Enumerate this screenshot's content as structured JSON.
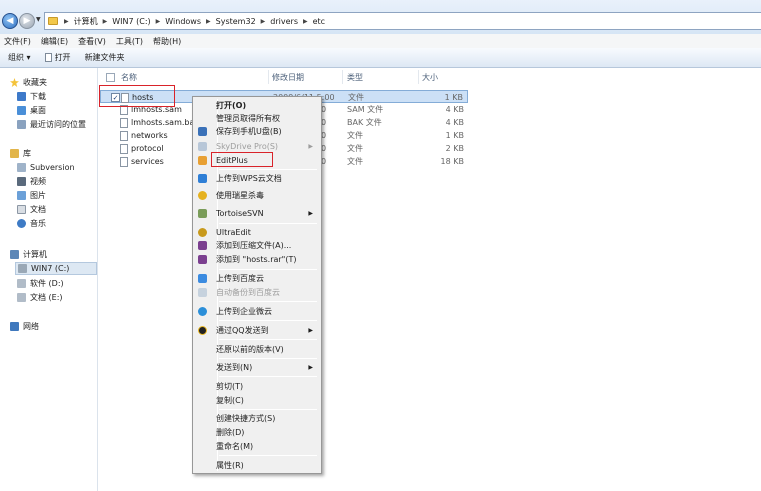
{
  "breadcrumb": {
    "items": [
      "计算机",
      "WIN7 (C:)",
      "Windows",
      "System32",
      "drivers",
      "etc"
    ]
  },
  "menubar": {
    "items": [
      "文件(F)",
      "编辑(E)",
      "查看(V)",
      "工具(T)",
      "帮助(H)"
    ]
  },
  "toolbar": {
    "organize": "组织 ▾",
    "open": "打开",
    "new_folder": "新建文件夹"
  },
  "nav": {
    "favorites": "收藏夹",
    "downloads": "下载",
    "desktop": "桌面",
    "recent": "最近访问的位置",
    "libraries": "库",
    "subversion": "Subversion",
    "videos": "视频",
    "pictures": "图片",
    "documents": "文档",
    "music": "音乐",
    "computer": "计算机",
    "drive_c": "WIN7 (C:)",
    "drive_d": "软件 (D:)",
    "drive_e": "文档 (E:)",
    "network": "网络"
  },
  "columns": {
    "name": "名称",
    "modified": "修改日期",
    "type": "类型",
    "size": "大小"
  },
  "files": [
    {
      "name": "hosts",
      "modified": "2009/6/11 5:00",
      "type": "文件",
      "size": "1 KB",
      "checked": "✓"
    },
    {
      "name": "lmhosts.sam",
      "modified": "0",
      "type": "SAM 文件",
      "size": "4 KB"
    },
    {
      "name": "lmhosts.sam.bak",
      "modified": "0",
      "type": "BAK 文件",
      "size": "4 KB"
    },
    {
      "name": "networks",
      "modified": "0",
      "type": "文件",
      "size": "1 KB"
    },
    {
      "name": "protocol",
      "modified": "0",
      "type": "文件",
      "size": "2 KB"
    },
    {
      "name": "services",
      "modified": "0",
      "type": "文件",
      "size": "18 KB"
    }
  ],
  "context_menu": {
    "open": "打开(O)",
    "take_ownership": "管理员取得所有权",
    "save_to_phone": "保存到手机U盘(B)",
    "skydrive": "SkyDrive Pro(S)",
    "editplus": "EditPlus",
    "upload_wps": "上传到WPS云文档",
    "antivirus": "使用瑞星杀毒",
    "tortoisesvn": "TortoiseSVN",
    "ultraedit": "UltraEdit",
    "add_archive": "添加到压缩文件(A)...",
    "add_hosts_rar": "添加到 \"hosts.rar\"(T)",
    "upload_baidu": "上传到百度云",
    "auto_backup_baidu": "自动备份到百度云",
    "upload_weiyun": "上传到企业微云",
    "send_qq": "通过QQ发送到",
    "restore_prev": "还原以前的版本(V)",
    "send_to": "发送到(N)",
    "cut": "剪切(T)",
    "copy": "复制(C)",
    "create_shortcut": "创建快捷方式(S)",
    "delete": "删除(D)",
    "rename": "重命名(M)",
    "properties": "属性(R)",
    "submenu_arrow": "▶"
  },
  "colors": {
    "highlight_red": "#d9232a",
    "selection_blue": "#cce0f6"
  }
}
